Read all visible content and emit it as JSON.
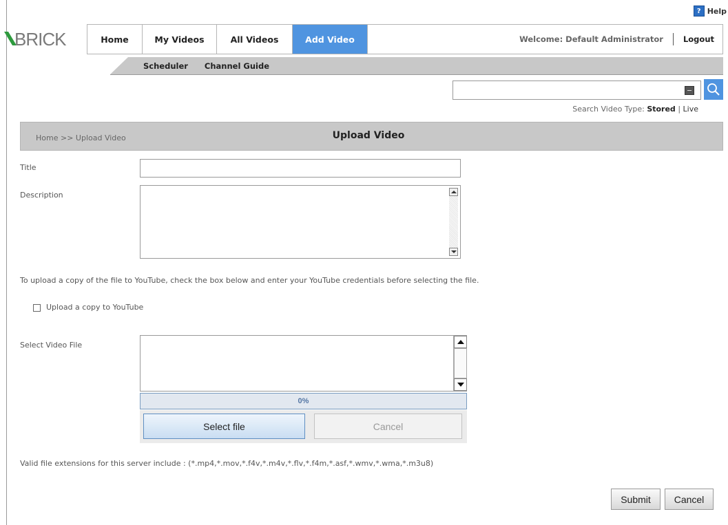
{
  "help": {
    "icon_char": "?",
    "label": "Help"
  },
  "logo": {
    "text": "BRICK"
  },
  "nav": {
    "tabs": [
      {
        "label": "Home",
        "active": false
      },
      {
        "label": "My Videos",
        "active": false
      },
      {
        "label": "All Videos",
        "active": false
      },
      {
        "label": "Add Video",
        "active": true
      }
    ],
    "welcome": "Welcome: Default Administrator",
    "logout": "Logout"
  },
  "subnav": {
    "items": [
      "Scheduler",
      "Channel Guide"
    ]
  },
  "search": {
    "value": "",
    "type_label": "Search Video Type:",
    "stored": "Stored",
    "separator": "|",
    "live": "Live"
  },
  "page": {
    "breadcrumb": "Home >> Upload Video",
    "title": "Upload Video"
  },
  "form": {
    "title_label": "Title",
    "title_value": "",
    "description_label": "Description",
    "description_value": "",
    "youtube_note": "To upload a copy of the file to YouTube, check the box below and enter your YouTube credentials before selecting the file.",
    "youtube_checkbox_label": "Upload a copy to YouTube",
    "youtube_checked": false,
    "select_file_label": "Select Video File",
    "progress": "0%",
    "select_file_button": "Select file",
    "cancel_file_button": "Cancel",
    "valid_extensions": "Valid file extensions for this server include : (*.mp4,*.mov,*.f4v,*.m4v,*.flv,*.f4m,*.asf,*.wmv,*.wma,*.m3u8)",
    "submit_button": "Submit",
    "cancel_button": "Cancel"
  },
  "colors": {
    "accent": "#4f94e0",
    "header_gray": "#c8c8c8",
    "border": "#b5b5b5"
  }
}
